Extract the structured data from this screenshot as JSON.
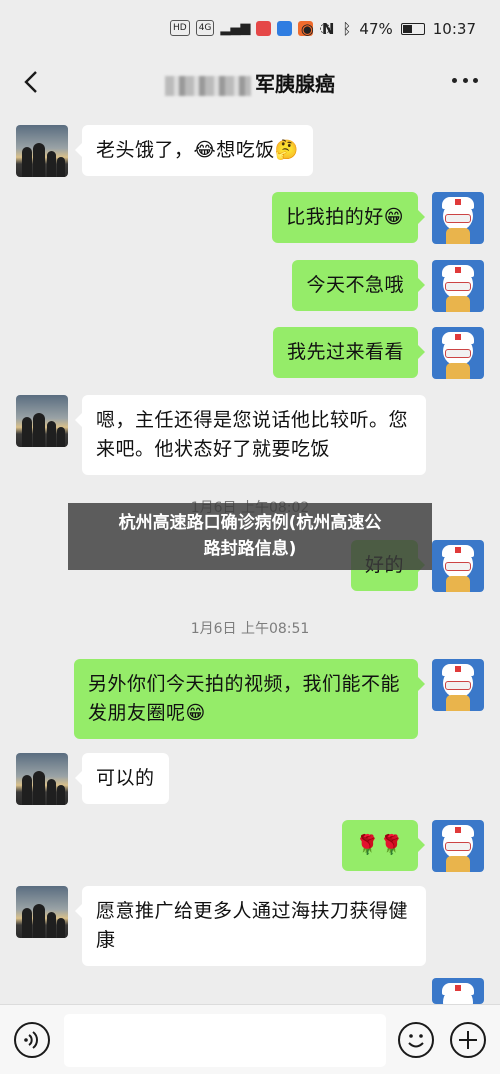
{
  "status_bar": {
    "left_chips": [
      "HD",
      "4G"
    ],
    "battery": "47%",
    "battery_level": 0.47,
    "time": "10:37"
  },
  "header": {
    "title_visible": "胰腺癌",
    "title_prefix_partial": "军"
  },
  "messages": [
    {
      "side": "left",
      "text": "老头饿了，😂想吃饭🤔"
    },
    {
      "side": "right",
      "text": "比我拍的好😁"
    },
    {
      "side": "right",
      "text": "今天不急哦"
    },
    {
      "side": "right",
      "text": "我先过来看看"
    },
    {
      "side": "left",
      "text": "嗯，主任还得是您说话他比较听。您来吧。他状态好了就要吃饭"
    },
    {
      "side": "time",
      "text": "1月6日 上午08:02"
    },
    {
      "side": "right",
      "text": "好的"
    },
    {
      "side": "time",
      "text": "1月6日 上午08:51"
    },
    {
      "side": "right",
      "text": "另外你们今天拍的视频，我们能不能发朋友圈呢😁"
    },
    {
      "side": "left",
      "text": "可以的"
    },
    {
      "side": "right",
      "text": "🌹🌹"
    },
    {
      "side": "left",
      "text": "愿意推广给更多人通过海扶刀获得健康"
    }
  ],
  "watermark": {
    "line1": "杭州高速路口确诊病例(杭州高速公",
    "line2": "路封路信息)"
  },
  "input_bar": {
    "placeholder": ""
  },
  "colors": {
    "background": "#ededed",
    "bubble_self": "#95ec69",
    "bubble_other": "#ffffff"
  }
}
